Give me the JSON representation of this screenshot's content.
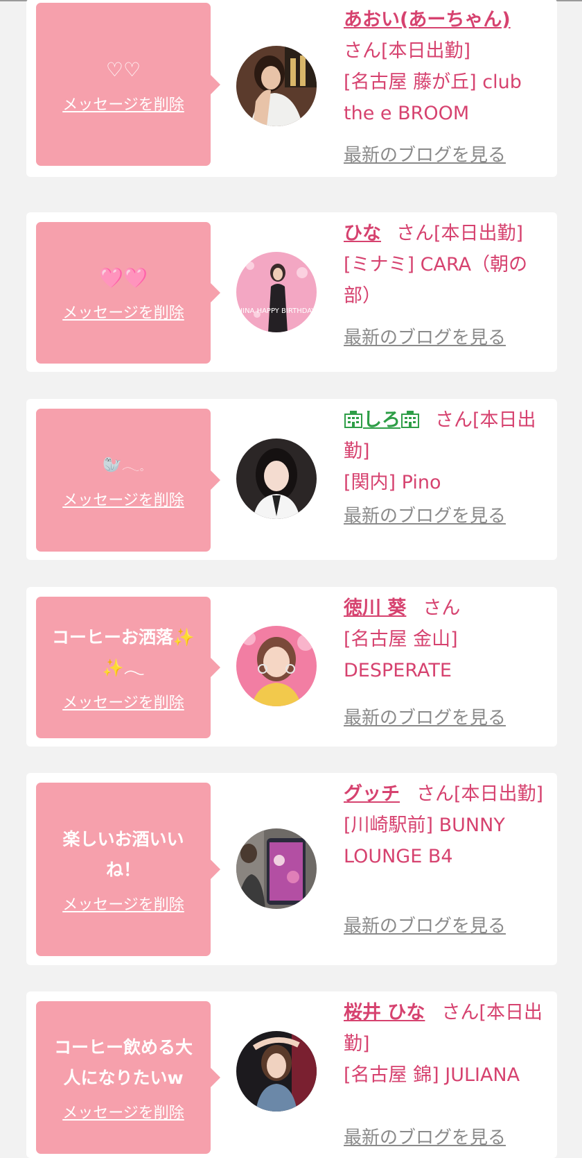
{
  "delete_label": "メッセージを削除",
  "blog_label": "最新のブログを見る",
  "colors": {
    "bubble": "#f6a0ac",
    "name": "#d6426f",
    "link": "#8a8a8a",
    "background": "#f2f2f2",
    "card": "#ffffff",
    "green_name": "#2e9e47"
  },
  "entries": [
    {
      "message": "♡♡",
      "name": "あおい(あーちゃん)",
      "suffix": "さん[本日出勤]",
      "shop": "[名古屋 藤が丘] club the e BROOM"
    },
    {
      "message": "🩷🩷",
      "name": "ひな",
      "suffix": "さん[本日出勤]",
      "shop": "[ミナミ] CARA（朝の部）",
      "avatar_text": "HINA HAPPY BIRTHDAY"
    },
    {
      "message": "🦭𓂃𓈒",
      "name": "しろ",
      "name_icon": "office-building-icon",
      "suffix": "さん[本日出勤]",
      "shop": "[関内] Pino"
    },
    {
      "message": "コーヒーお洒落✨✨𓂃",
      "name": "徳川 葵",
      "suffix": "さん",
      "shop": "[名古屋 金山] DESPERATE"
    },
    {
      "message": "楽しいお酒いいね！",
      "name": "グッチ",
      "suffix": "さん[本日出勤]",
      "shop": "[川崎駅前] BUNNY LOUNGE B4"
    },
    {
      "message": "コーヒー飲める大人になりたいw",
      "name": "桜井 ひな",
      "suffix": "さん[本日出勤]",
      "shop": "[名古屋 錦] JULIANA"
    }
  ]
}
